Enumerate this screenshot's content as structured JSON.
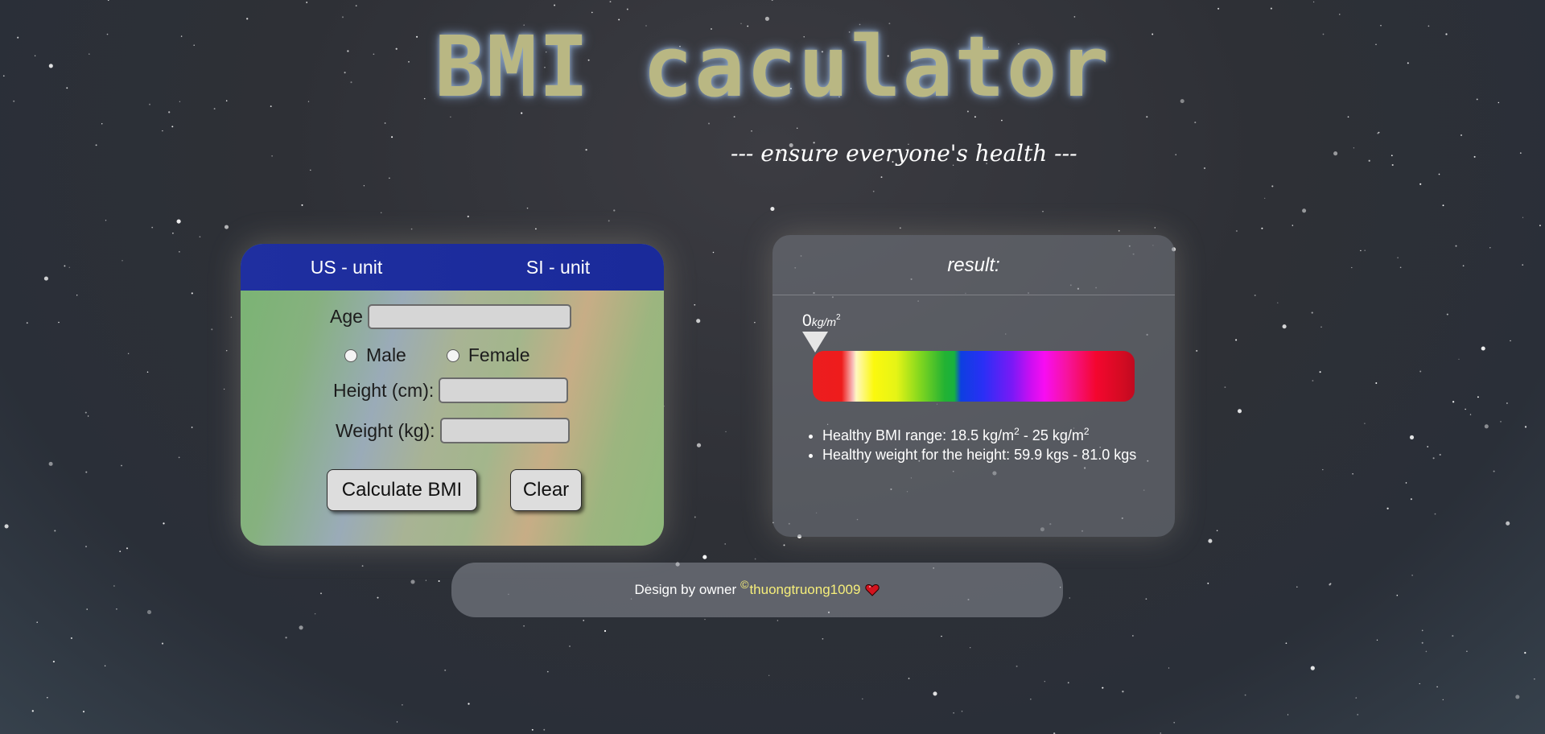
{
  "header": {
    "title": "BMI caculator",
    "subtitle": "--- ensure everyone's health ---"
  },
  "calculator": {
    "tabs": [
      {
        "label": "US - unit"
      },
      {
        "label": "SI - unit"
      }
    ],
    "age_label": "Age",
    "age_value": "",
    "gender_options": [
      {
        "label": "Male",
        "selected": false
      },
      {
        "label": "Female",
        "selected": false
      }
    ],
    "height_label": "Height (cm):",
    "height_value": "",
    "weight_label": "Weight (kg):",
    "weight_value": "",
    "calculate_label": "Calculate BMI",
    "clear_label": "Clear"
  },
  "result": {
    "title": "result:",
    "bmi_value": "0",
    "bmi_unit": "kg/m",
    "bmi_unit_exp": "2",
    "pointer_fraction": 0,
    "spectrum_colors": [
      "#ec1d1f",
      "#fbf80e",
      "#23b233",
      "#0d3fe0",
      "#f70df2",
      "#c00a20"
    ],
    "healthy_range_text": "Healthy BMI range: 18.5 kg/m",
    "healthy_range_exp": "2",
    "healthy_range_mid": " - 25 kg/m",
    "healthy_range_exp2": "2",
    "healthy_weight_text": "Healthy weight for the height: 59.9 kgs - 81.0 kgs"
  },
  "footer": {
    "prefix": "Design by owner",
    "copyright_symbol": "©",
    "author": "thuongtruong1009",
    "heart_icon": "heart-icon"
  },
  "colors": {
    "title": "#b9b783",
    "tab_bar": "#1f2fa0",
    "author_link": "#f6ee7a"
  }
}
